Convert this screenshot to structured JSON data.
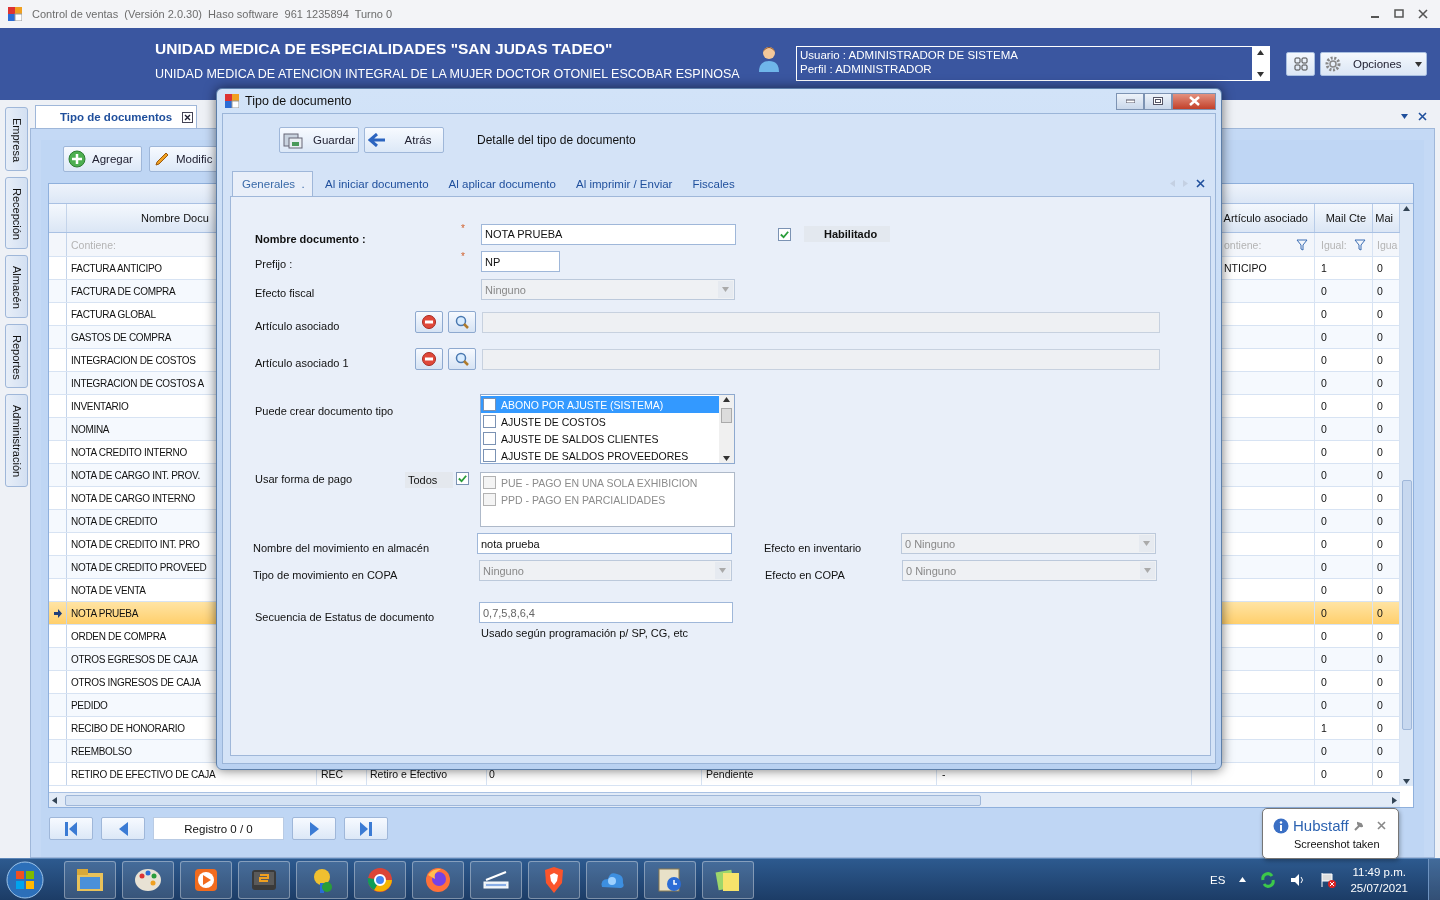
{
  "window": {
    "title": "Control de ventas  (Versión 2.0.30)  Haso software  961 1235894  Turno 0"
  },
  "header": {
    "title": "UNIDAD MEDICA DE ESPECIALIDADES  \"SAN JUDAS TADEO\"",
    "subtitle": "UNIDAD MEDICA DE ATENCION INTEGRAL DE LA MUJER DOCTOR OTONIEL ESCOBAR ESPINOSA",
    "user_lines": [
      "Usuario : ADMINISTRADOR DE SISTEMA",
      "Perfil : ADMINISTRADOR"
    ],
    "options_button": "Opciones"
  },
  "side_tabs": [
    "Empresa",
    "Recepción",
    "Almacén",
    "Reportes",
    "Administración"
  ],
  "document_tab": {
    "label": "Tipo de documentos"
  },
  "toolbar": [
    {
      "label": "Agregar",
      "kind": "add"
    },
    {
      "label": "Modific",
      "kind": "edit"
    }
  ],
  "grid": {
    "headers": {
      "name": "Nombre Docu",
      "article": "Artículo asociado",
      "mail_cte": "Mail Cte",
      "column_9": "Mai"
    },
    "filters": {
      "name": "Contiene:",
      "article": "ontiene:",
      "mail_cte": "Igual:",
      "column_9": "Igua"
    },
    "rows": [
      {
        "selected": false,
        "name": "FACTURA ANTICIPO",
        "article": "NTICIPO",
        "mail_cte": "1",
        "column_9": "0"
      },
      {
        "selected": false,
        "name": "FACTURA DE COMPRA",
        "mail_cte": "0",
        "column_9": "0"
      },
      {
        "selected": false,
        "name": "FACTURA GLOBAL",
        "mail_cte": "0",
        "column_9": "0"
      },
      {
        "selected": false,
        "name": "GASTOS DE COMPRA",
        "mail_cte": "0",
        "column_9": "0"
      },
      {
        "selected": false,
        "name": "INTEGRACION DE COSTOS",
        "mail_cte": "0",
        "column_9": "0"
      },
      {
        "selected": false,
        "name": "INTEGRACION DE COSTOS A",
        "mail_cte": "0",
        "column_9": "0"
      },
      {
        "selected": false,
        "name": "INVENTARIO",
        "mail_cte": "0",
        "column_9": "0"
      },
      {
        "selected": false,
        "name": "NOMINA",
        "mail_cte": "0",
        "column_9": "0"
      },
      {
        "selected": false,
        "name": "NOTA CREDITO INTERNO",
        "mail_cte": "0",
        "column_9": "0"
      },
      {
        "selected": false,
        "name": "NOTA DE CARGO INT. PROV.",
        "mail_cte": "0",
        "column_9": "0"
      },
      {
        "selected": false,
        "name": "NOTA DE CARGO INTERNO",
        "mail_cte": "0",
        "column_9": "0"
      },
      {
        "selected": false,
        "name": "NOTA DE CREDITO",
        "mail_cte": "0",
        "column_9": "0"
      },
      {
        "selected": false,
        "name": "NOTA DE CREDITO INT. PRO",
        "mail_cte": "0",
        "column_9": "0"
      },
      {
        "selected": false,
        "name": "NOTA DE CREDITO PROVEED",
        "mail_cte": "0",
        "column_9": "0"
      },
      {
        "selected": false,
        "name": "NOTA DE VENTA",
        "mail_cte": "0",
        "column_9": "0"
      },
      {
        "selected": true,
        "name": "NOTA PRUEBA",
        "mail_cte": "0",
        "column_9": "0"
      },
      {
        "selected": false,
        "name": "ORDEN DE COMPRA",
        "mail_cte": "0",
        "column_9": "0"
      },
      {
        "selected": false,
        "name": "OTROS EGRESOS DE CAJA",
        "mail_cte": "0",
        "column_9": "0"
      },
      {
        "selected": false,
        "name": "OTROS INGRESOS DE CAJA",
        "mail_cte": "0",
        "column_9": "0"
      },
      {
        "selected": false,
        "name": "PEDIDO",
        "mail_cte": "0",
        "column_9": "0"
      },
      {
        "selected": false,
        "name": "RECIBO DE HONORARIO",
        "mail_cte": "1",
        "column_9": "0"
      },
      {
        "selected": false,
        "name": "REEMBOLSO",
        "mail_cte": "0",
        "column_9": "0"
      },
      {
        "selected": false,
        "name": "RETIRO DE EFECTIVO DE CAJA",
        "code": "REC",
        "movement": "Retiro e Efectivo",
        "column_4": "0",
        "status": "Pendiente",
        "column_6": "-",
        "mail_cte": "0",
        "column_9": "0"
      }
    ]
  },
  "navigator": {
    "record": "Registro 0 / 0"
  },
  "dialog": {
    "title": "Tipo de documento",
    "buttons": [
      {
        "label": "Guardar",
        "kind": "save"
      },
      {
        "label": "Atrás",
        "kind": "back"
      }
    ],
    "heading": "Detalle del tipo de documento",
    "tabs": [
      {
        "label": "Generales  .",
        "selected": true
      },
      {
        "label": "Al iniciar documento",
        "selected": false
      },
      {
        "label": "Al aplicar documento",
        "selected": false
      },
      {
        "label": "Al imprimir / Enviar",
        "selected": false
      },
      {
        "label": "Fiscales",
        "selected": false
      }
    ],
    "form": {
      "name": {
        "label": "Nombre documento :",
        "required_mark": "*",
        "value": "NOTA PRUEBA"
      },
      "enabled": {
        "label": "Habilitado",
        "checked": true
      },
      "prefix": {
        "label": "Prefijo :",
        "required_mark": "*",
        "value": "NP"
      },
      "fiscal_effect": {
        "label": "Efecto fiscal",
        "value": "Ninguno",
        "disabled": true
      },
      "articles": [
        {
          "label": "Artículo asociado",
          "disabled": true
        },
        {
          "label": "Artículo asociado 1",
          "disabled": true
        }
      ],
      "can_create": {
        "label": "Puede crear documento tipo",
        "items": [
          {
            "label": "ABONO POR AJUSTE (SISTEMA)",
            "checked": false,
            "selected": true
          },
          {
            "label": "AJUSTE DE COSTOS",
            "checked": false,
            "selected": false
          },
          {
            "label": "AJUSTE DE SALDOS CLIENTES",
            "checked": false,
            "selected": false
          },
          {
            "label": "AJUSTE DE SALDOS PROVEEDORES",
            "checked": false,
            "selected": false
          }
        ]
      },
      "payment": {
        "label": "Usar forma de pago",
        "all_label": "Todos",
        "all_checked": true,
        "disabled": true,
        "items": [
          {
            "label": "PUE - PAGO EN UNA SOLA EXHIBICION",
            "checked": false
          },
          {
            "label": "PPD - PAGO EN PARCIALIDADES",
            "checked": false
          }
        ]
      },
      "warehouse_movement": {
        "label": "Nombre del movimiento en almacén",
        "value": "nota prueba"
      },
      "inventory_effect": {
        "label": "Efecto en inventario",
        "value": "0 Ninguno",
        "disabled": true
      },
      "copa_type": {
        "label": "Tipo de movimiento en COPA",
        "value": "Ninguno",
        "disabled": true
      },
      "copa_effect": {
        "label": "Efecto en COPA",
        "value": "0 Ninguno",
        "disabled": true
      },
      "status_sequence": {
        "label": "Secuencia de Estatus de documento",
        "value": "0,7,5,8,6,4",
        "disabled": true,
        "hint": "Usado según programación p/ SP, CG, etc"
      }
    }
  },
  "taskbar": {
    "language": "ES",
    "time": "11:49 p.m.",
    "date": "25/07/2021"
  },
  "notification": {
    "app": "Hubstaff",
    "message": "Screenshot taken"
  }
}
